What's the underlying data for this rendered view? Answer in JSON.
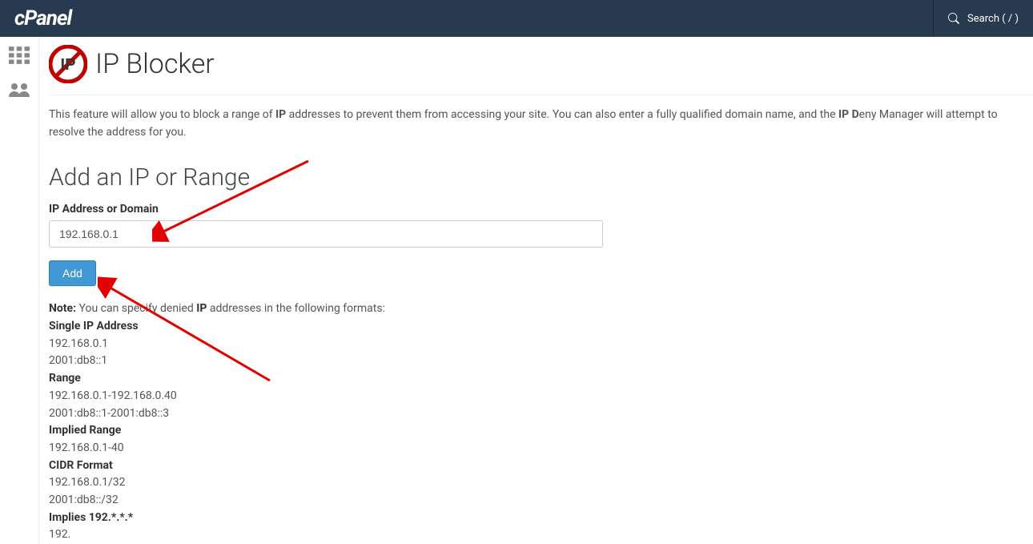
{
  "logo": "cPanel",
  "search": {
    "label": "Search ( / )"
  },
  "page": {
    "title": "IP Blocker",
    "desc_pre": "This feature will allow you to block a range of ",
    "desc_bold1": "IP",
    "desc_mid": " addresses to prevent them from accessing your site. You can also enter a fully qualified domain name, and the ",
    "desc_bold2": "IP D",
    "desc_post": "eny Manager will attempt to resolve the address for you."
  },
  "section": {
    "heading": "Add an IP or Range",
    "field_label": "IP Address or Domain",
    "input_value": "192.168.0.1",
    "button": "Add"
  },
  "note": {
    "label": "Note:",
    "intro_pre": " You can specify denied ",
    "intro_bold": "IP",
    "intro_post": " addresses in the following formats:",
    "single_h": "Single IP Address",
    "single_1": "192.168.0.1",
    "single_2": "2001:db8::1",
    "range_h": "Range",
    "range_1": "192.168.0.1-192.168.0.40",
    "range_2": "2001:db8::1-2001:db8::3",
    "implied_h": "Implied Range",
    "implied_1": "192.168.0.1-40",
    "cidr_h": "CIDR Format",
    "cidr_1": "192.168.0.1/32",
    "cidr_2": "2001:db8::/32",
    "implies_h": "Implies 192.*.*.*",
    "implies_1": "192."
  }
}
